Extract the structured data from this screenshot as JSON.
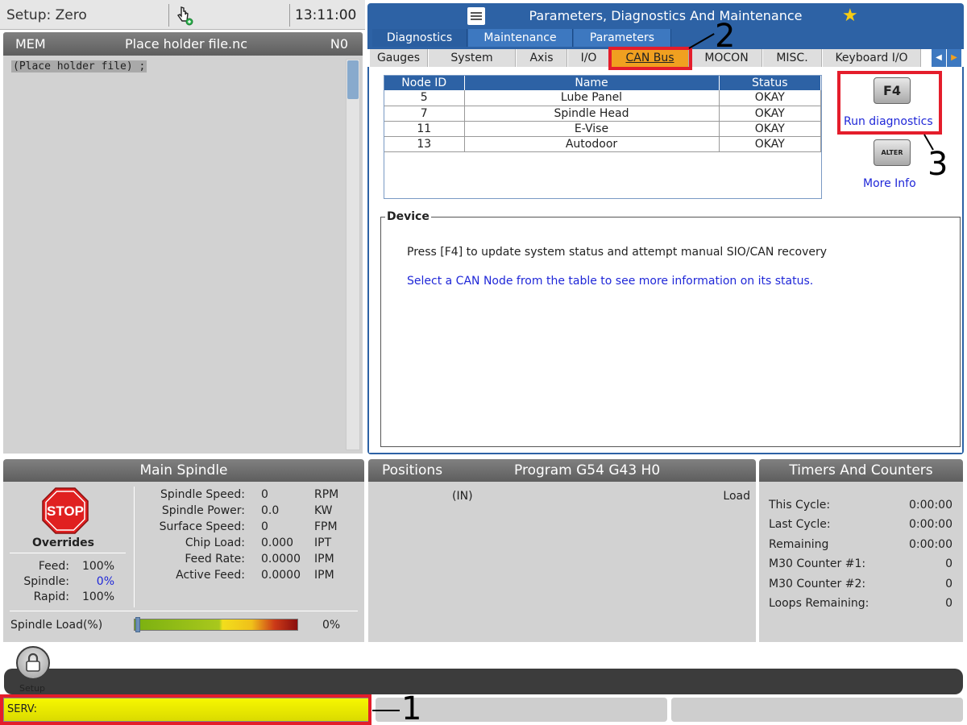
{
  "top_status": {
    "mode": "Setup: Zero",
    "clock": "13:11:00"
  },
  "program": {
    "mode": "MEM",
    "file": "Place holder file.nc",
    "line": "N0",
    "code": "(Place holder file) ;"
  },
  "pdm": {
    "title": "Parameters, Diagnostics And Maintenance",
    "tabs_top": [
      "Diagnostics",
      "Maintenance",
      "Parameters"
    ],
    "tabs_sub": [
      "Gauges",
      "System",
      "Axis",
      "I/O",
      "CAN Bus",
      "MOCON",
      "MISC.",
      "Keyboard I/O"
    ],
    "can_table": {
      "headers": [
        "Node ID",
        "Name",
        "Status"
      ],
      "rows": [
        {
          "id": "5",
          "name": "Lube Panel",
          "status": "OKAY"
        },
        {
          "id": "7",
          "name": "Spindle Head",
          "status": "OKAY"
        },
        {
          "id": "11",
          "name": "E-Vise",
          "status": "OKAY"
        },
        {
          "id": "13",
          "name": "Autodoor",
          "status": "OKAY"
        }
      ]
    },
    "f4_key": "F4",
    "run_diagnostics": "Run diagnostics",
    "alter_key": "ALTER",
    "more_info": "More Info",
    "device": {
      "legend": "Device",
      "text": "Press [F4] to update system status and attempt manual SIO/CAN recovery",
      "hint": "Select a CAN Node from the table to see more information on its status."
    }
  },
  "spindle": {
    "title": "Main Spindle",
    "stop_label": "STOP",
    "overrides_title": "Overrides",
    "overrides": [
      {
        "label": "Feed:",
        "value": "100%"
      },
      {
        "label": "Spindle:",
        "value": "0%"
      },
      {
        "label": "Rapid:",
        "value": "100%"
      }
    ],
    "metrics": [
      {
        "label": "Spindle Speed:",
        "value": "0",
        "unit": "RPM"
      },
      {
        "label": "Spindle Power:",
        "value": "0.0",
        "unit": "KW"
      },
      {
        "label": "Surface Speed:",
        "value": "0",
        "unit": "FPM"
      },
      {
        "label": "Chip Load:",
        "value": "0.000",
        "unit": "IPT"
      },
      {
        "label": "Feed Rate:",
        "value": "0.0000",
        "unit": "IPM"
      },
      {
        "label": "Active Feed:",
        "value": "0.0000",
        "unit": "IPM"
      }
    ],
    "load_label": "Spindle Load(%)",
    "load_value": "0%",
    "load_fraction": 0.0
  },
  "positions": {
    "title": "Positions",
    "program": "Program G54 G43 H0",
    "unit": "(IN)",
    "load": "Load"
  },
  "timers": {
    "title": "Timers And Counters",
    "rows": [
      {
        "label": "This Cycle:",
        "value": "0:00:00"
      },
      {
        "label": "Last Cycle:",
        "value": "0:00:00"
      },
      {
        "label": "Remaining",
        "value": "0:00:00"
      },
      {
        "label": "M30 Counter #1:",
        "value": "0"
      },
      {
        "label": "M30 Counter #2:",
        "value": "0"
      },
      {
        "label": "Loops Remaining:",
        "value": "0"
      }
    ]
  },
  "nav": {
    "setup_label": "Setup"
  },
  "status_line": {
    "serv": "SERV:"
  },
  "callouts": [
    "1",
    "2",
    "3"
  ],
  "colors": {
    "accent": "#2d62a5",
    "active_tab": "#f0a020",
    "callout_red": "#e41d2b",
    "serv_yellow": "#f2f200",
    "link_blue": "#1f27d8"
  }
}
